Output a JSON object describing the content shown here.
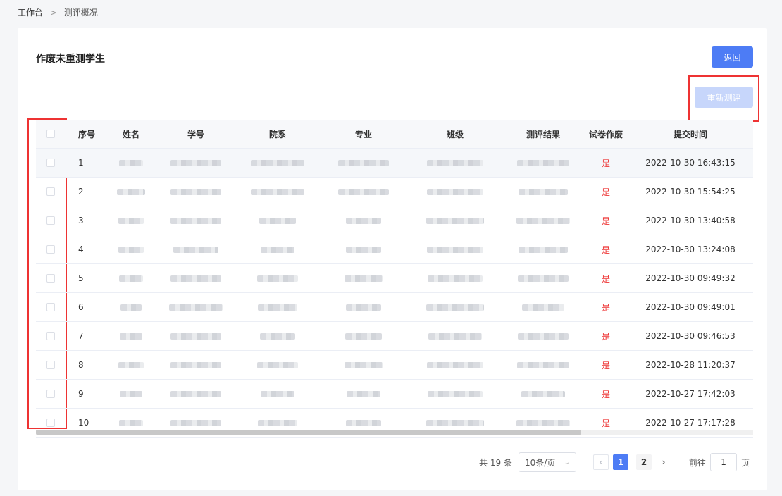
{
  "breadcrumb": {
    "root": "工作台",
    "separator": ">",
    "current": "测评概况"
  },
  "page": {
    "title": "作废未重测学生"
  },
  "buttons": {
    "back": "返回",
    "retest": "重新测评"
  },
  "table": {
    "headers": {
      "index": "序号",
      "name": "姓名",
      "student_id": "学号",
      "department": "院系",
      "major": "专业",
      "class": "班级",
      "result": "测评结果",
      "voided": "试卷作废",
      "submit_time": "提交时间"
    },
    "rows": [
      {
        "index": "1",
        "voided": "是",
        "submit_time": "2022-10-30 16:43:15"
      },
      {
        "index": "2",
        "voided": "是",
        "submit_time": "2022-10-30 15:54:25"
      },
      {
        "index": "3",
        "voided": "是",
        "submit_time": "2022-10-30 13:40:58"
      },
      {
        "index": "4",
        "voided": "是",
        "submit_time": "2022-10-30 13:24:08"
      },
      {
        "index": "5",
        "voided": "是",
        "submit_time": "2022-10-30 09:49:32"
      },
      {
        "index": "6",
        "voided": "是",
        "submit_time": "2022-10-30 09:49:01"
      },
      {
        "index": "7",
        "voided": "是",
        "submit_time": "2022-10-30 09:46:53"
      },
      {
        "index": "8",
        "voided": "是",
        "submit_time": "2022-10-28 11:20:37"
      },
      {
        "index": "9",
        "voided": "是",
        "submit_time": "2022-10-27 17:42:03"
      },
      {
        "index": "10",
        "voided": "是",
        "submit_time": "2022-10-27 17:17:28"
      }
    ]
  },
  "pagination": {
    "total": "共 19 条",
    "page_size": "10条/页",
    "pages": [
      "1",
      "2"
    ],
    "current_page": "1",
    "goto_prefix": "前往",
    "goto_value": "1",
    "goto_suffix": "页"
  },
  "colors": {
    "primary": "#4d7cf5",
    "primary_disabled": "#c7d6fb",
    "danger": "#e33333",
    "annotation_box": "#e33333"
  },
  "icons": {
    "sort": "chevron-down-icon",
    "prev": "chevron-left-icon",
    "next": "chevron-right-icon"
  }
}
